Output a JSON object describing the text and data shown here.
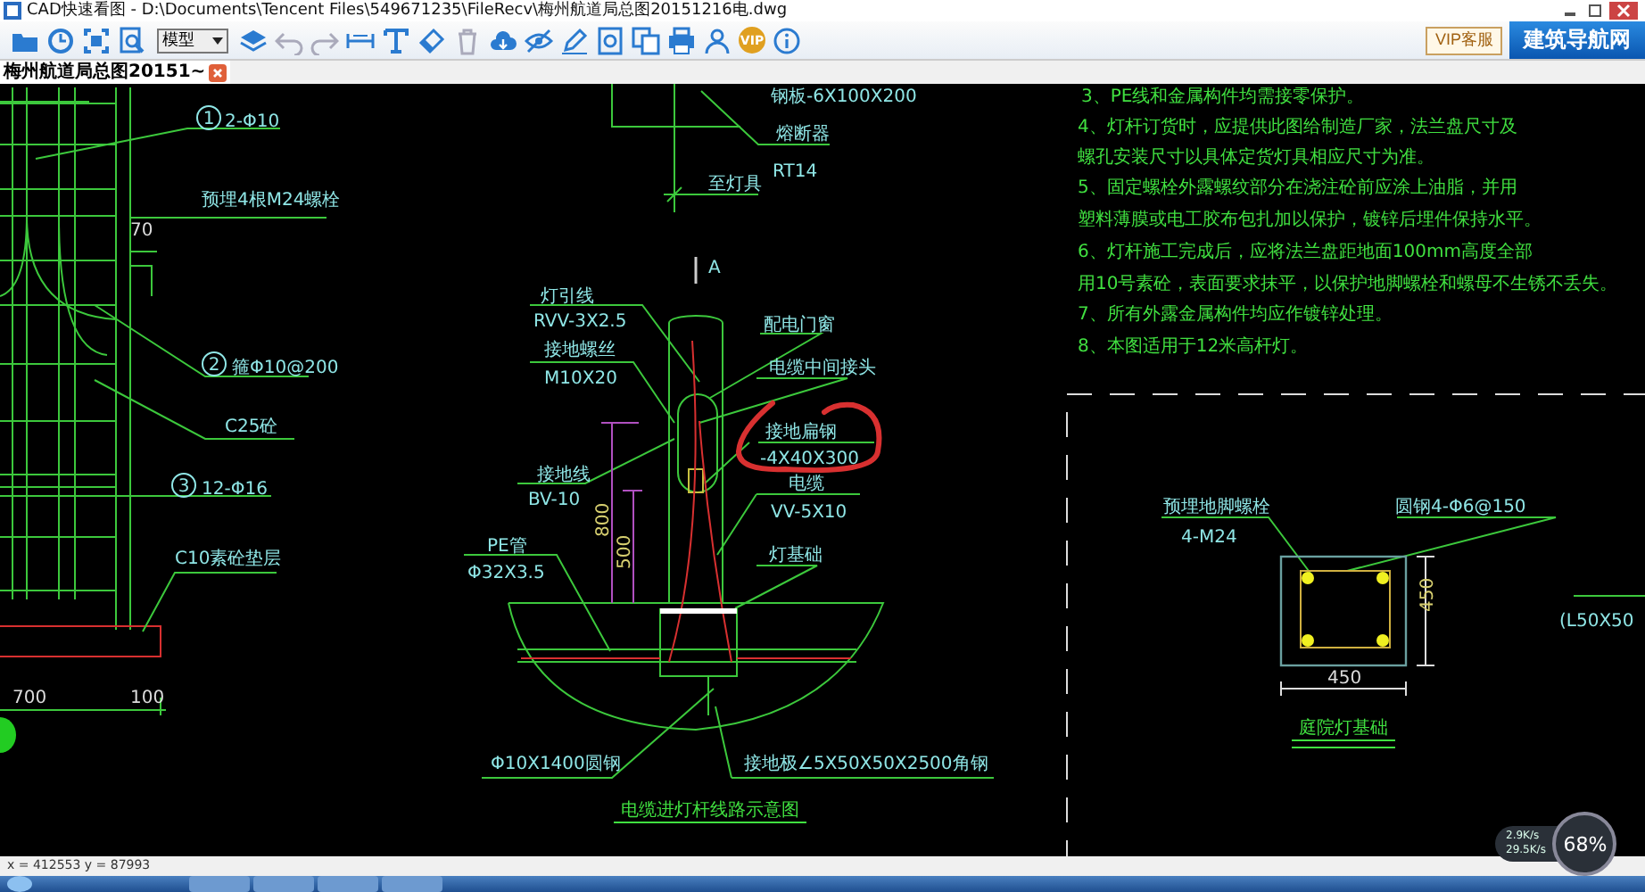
{
  "window": {
    "title": "CAD快速看图 - D:\\Documents\\Tencent Files\\549671235\\FileRecv\\梅州航道局总图20151216电.dwg"
  },
  "toolbar": {
    "view_select": "模型",
    "vip_badge": "VIP",
    "vip_service": "VIP客服",
    "brand_banner": "建筑导航网"
  },
  "tabs": [
    {
      "label": "梅州航道局总图20151~",
      "selected": true
    }
  ],
  "drawing": {
    "column_detail": [
      {
        "text": "1",
        "kind": "callout"
      },
      {
        "text": "2-Φ10",
        "kind": "label"
      },
      {
        "text": "预埋4根M24螺栓",
        "kind": "label"
      },
      {
        "text": "70",
        "kind": "dimension"
      },
      {
        "text": "2",
        "kind": "callout"
      },
      {
        "text": "箍Φ10@200",
        "kind": "label"
      },
      {
        "text": "C25砼",
        "kind": "label"
      },
      {
        "text": "3",
        "kind": "callout"
      },
      {
        "text": "12-Φ16",
        "kind": "label"
      },
      {
        "text": "C10素砼垫层",
        "kind": "label"
      },
      {
        "text": "700",
        "kind": "dimension"
      },
      {
        "text": "100",
        "kind": "dimension"
      }
    ],
    "section_view": [
      {
        "text": "钢板-6X100X200",
        "kind": "label"
      },
      {
        "text": "熔断器",
        "kind": "label"
      },
      {
        "text": "RT14",
        "kind": "label"
      },
      {
        "text": "至灯具",
        "kind": "label"
      },
      {
        "text": "A",
        "kind": "label"
      },
      {
        "text": "灯引线",
        "kind": "label"
      },
      {
        "text": "RVV-3X2.5",
        "kind": "label"
      },
      {
        "text": "接地螺丝",
        "kind": "label"
      },
      {
        "text": "M10X20",
        "kind": "label"
      },
      {
        "text": "配电门窗",
        "kind": "label"
      },
      {
        "text": "电缆中间接头",
        "kind": "label"
      },
      {
        "text": "接地扁钢",
        "kind": "label"
      },
      {
        "text": "-4X40X300",
        "kind": "label"
      },
      {
        "text": "电缆",
        "kind": "label"
      },
      {
        "text": "VV-5X10",
        "kind": "label"
      },
      {
        "text": "接地线",
        "kind": "label"
      },
      {
        "text": "BV-10",
        "kind": "label"
      },
      {
        "text": "PE管",
        "kind": "label"
      },
      {
        "text": "Φ32X3.5",
        "kind": "label"
      },
      {
        "text": "灯基础",
        "kind": "label"
      },
      {
        "text": "800",
        "kind": "vdimension"
      },
      {
        "text": "500",
        "kind": "vdimension"
      },
      {
        "text": "Φ10X1400圆钢",
        "kind": "label"
      },
      {
        "text": "接地极∠5X50X50X2500角钢",
        "kind": "label"
      },
      {
        "text": "电缆进灯杆线路示意图",
        "kind": "title"
      }
    ],
    "notes": [
      "3、PE线和金属构件均需接零保护。",
      "4、灯杆订货时，应提供此图给制造厂家，法兰盘尺寸及",
      "螺孔安装尺寸以具体定货灯具相应尺寸为准。",
      "5、固定螺栓外露螺纹部分在浇注砼前应涂上油脂，并用",
      "塑料薄膜或电工胶布包扎加以保护，镀锌后埋件保持水平。",
      "6、灯杆施工完成后，应将法兰盘距地面100mm高度全部",
      "用10号素砼，表面要求抹平，以保护地脚螺栓和螺母不生锈不丢失。",
      "7、所有外露金属构件均应作镀锌处理。",
      "8、本图适用于12米高杆灯。"
    ],
    "foundation_plan": [
      {
        "text": "预埋地脚螺栓",
        "kind": "label"
      },
      {
        "text": "4-M24",
        "kind": "label"
      },
      {
        "text": "圆钢4-Φ6@150",
        "kind": "label"
      },
      {
        "text": "450",
        "kind": "vdimension"
      },
      {
        "text": "450",
        "kind": "dimension"
      },
      {
        "text": "庭院灯基础",
        "kind": "title"
      },
      {
        "text": "(L50X50",
        "kind": "label"
      }
    ]
  },
  "status_bar": {
    "coordinates": "x = 412553  y = 87993"
  },
  "net_monitor": {
    "upload": "2.9K/s",
    "download": "29.5K/s",
    "usage": "68%"
  }
}
